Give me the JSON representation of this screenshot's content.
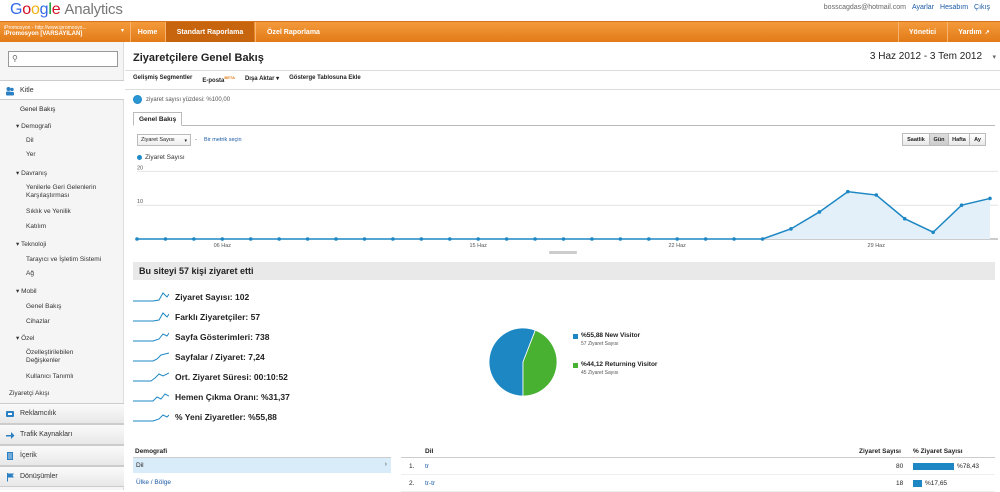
{
  "header": {
    "logo_google": [
      "G",
      "o",
      "o",
      "g",
      "l",
      "e"
    ],
    "logo_product": "Analytics",
    "user_email": "bosscagdas@hotmail.com",
    "links": [
      "Ayarlar",
      "Hesabım",
      "Çıkış"
    ]
  },
  "nav": {
    "account_line1": "iPromosyon - http://www.ipromosyo...",
    "account_line2": "iPromosyon [VARSAYILAN]",
    "tabs": [
      "Home",
      "Standart Raporlama",
      "Özel Raporlama"
    ],
    "right": [
      "Yönetici",
      "Yardım"
    ]
  },
  "sidebar": {
    "search_placeholder": "",
    "kitle": "Kitle",
    "items": [
      "Genel Bakış",
      "Demografi",
      "Dil",
      "Yer",
      "Davranış",
      "Yenilerle Geri Gelenlerin",
      "Karşılaştırması",
      "Sıklık ve Yenilik",
      "Katılım",
      "Teknoloji",
      "Tarayıcı ve İşletim Sistemi",
      "Ağ",
      "Mobil",
      "Genel Bakış",
      "Cihazlar",
      "Özel",
      "Özelleştirilebilen",
      "Değişkenler",
      "Kullanıcı Tanımlı",
      "Ziyaretçi Akışı"
    ],
    "sections": [
      "Reklamcılık",
      "Trafik Kaynakları",
      "İçerik",
      "Dönüşümler"
    ]
  },
  "main": {
    "title": "Ziyaretçilere Genel Bakış",
    "date_range": "3 Haz 2012 - 3 Tem 2012",
    "toolbar": [
      "Gelişmiş Segmentler",
      "E-posta",
      "Dışa Aktar ▾",
      "Gösterge Tablosuna Ekle"
    ],
    "beta": "BETA",
    "segment_text": "ziyaret sayısı yüzdesi: %100,00",
    "tab": "Genel Bakış",
    "metric_select": "Ziyaret Sayısı",
    "vs": "-",
    "metric_link": "Bir metrik seçin",
    "granularity": [
      "Saatlik",
      "Gün",
      "Hafta",
      "Ay"
    ],
    "legend": "Ziyaret Sayısı",
    "summary": "Bu siteyi 57 kişi ziyaret etti",
    "metrics": [
      "Ziyaret Sayısı: 102",
      "Farklı Ziyaretçiler: 57",
      "Sayfa Gösterimleri: 738",
      "Sayfalar / Ziyaret: 7,24",
      "Ort. Ziyaret Süresi: 00:10:52",
      "Hemen Çıkma Oranı: %31,37",
      "% Yeni Ziyaretler: %55,88"
    ],
    "pie": [
      {
        "pct": "%55,88",
        "label": "New Visitor",
        "sub": "57 Ziyaret Sayısı",
        "color": "#1d87c4",
        "value": 55.88
      },
      {
        "pct": "%44,12",
        "label": "Returning Visitor",
        "sub": "45 Ziyaret Sayısı",
        "color": "#48b132",
        "value": 44.12
      }
    ],
    "demographics": {
      "header": "Demografi",
      "row1": "Dil",
      "row2": "Ülke / Bölge"
    },
    "table": {
      "headers": [
        "Dil",
        "Ziyaret Sayısı",
        "% Ziyaret Sayısı"
      ],
      "rows": [
        {
          "n": "1.",
          "lang": "tr",
          "visits": "80",
          "pct": "%78,43",
          "frac": 0.7843
        },
        {
          "n": "2.",
          "lang": "tr-tr",
          "visits": "18",
          "pct": "%17,65",
          "frac": 0.1765
        }
      ]
    }
  },
  "chart_data": {
    "type": "area",
    "series": [
      {
        "name": "Ziyaret Sayısı",
        "values": [
          0,
          0,
          0,
          0,
          0,
          0,
          0,
          0,
          0,
          0,
          0,
          0,
          0,
          0,
          0,
          0,
          0,
          0,
          0,
          0,
          0,
          0,
          0,
          3,
          8,
          14,
          13,
          6,
          2,
          10,
          12
        ]
      }
    ],
    "x_tick_labels": [
      "06 Haz",
      "15 Haz",
      "22 Haz",
      "29 Haz"
    ],
    "x_tick_index": [
      3,
      12,
      19,
      26
    ],
    "y_tick_labels": [
      "10",
      "20"
    ],
    "ylim": [
      0,
      21
    ],
    "color": "#1d87c4"
  }
}
